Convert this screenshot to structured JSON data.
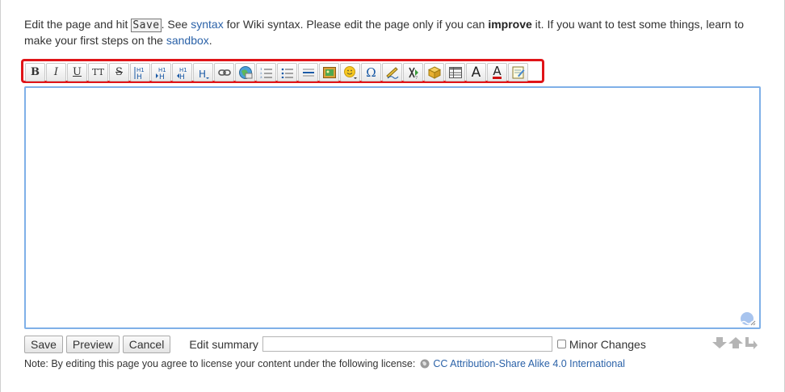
{
  "intro": {
    "part1": "Edit the page and hit ",
    "save_key": "Save",
    "part2": ". See ",
    "syntax_link": "syntax",
    "part3": " for Wiki syntax. Please edit the page only if you can ",
    "improve": "improve",
    "part4": " it. If you want to test some things, learn to make your first steps on the ",
    "sandbox_link": "sandbox",
    "part5": "."
  },
  "toolbar": {
    "highlight_color": "#e01418",
    "buttons": [
      {
        "name": "bold-button",
        "icon": "bold-icon",
        "label": "B"
      },
      {
        "name": "italic-button",
        "icon": "italic-icon",
        "label": "I"
      },
      {
        "name": "underline-button",
        "icon": "underline-icon",
        "label": "U"
      },
      {
        "name": "monospace-button",
        "icon": "monospace-icon",
        "label": "TT"
      },
      {
        "name": "strikethrough-button",
        "icon": "strikethrough-icon",
        "label": "S"
      },
      {
        "name": "same-level-heading-button",
        "icon": "heading-same-icon",
        "label": "H"
      },
      {
        "name": "lower-heading-button",
        "icon": "heading-lower-icon",
        "label": "H"
      },
      {
        "name": "higher-heading-button",
        "icon": "heading-higher-icon",
        "label": "H"
      },
      {
        "name": "select-heading-button",
        "icon": "heading-select-icon",
        "label": "H"
      },
      {
        "name": "internal-link-button",
        "icon": "link-icon",
        "label": ""
      },
      {
        "name": "external-link-button",
        "icon": "globe-link-icon",
        "label": ""
      },
      {
        "name": "ordered-list-button",
        "icon": "ordered-list-icon",
        "label": ""
      },
      {
        "name": "unordered-list-button",
        "icon": "unordered-list-icon",
        "label": ""
      },
      {
        "name": "horizontal-rule-button",
        "icon": "horizontal-rule-icon",
        "label": ""
      },
      {
        "name": "add-image-button",
        "icon": "image-icon",
        "label": ""
      },
      {
        "name": "smileys-button",
        "icon": "smiley-icon",
        "label": ""
      },
      {
        "name": "special-chars-button",
        "icon": "omega-icon",
        "label": "Ω"
      },
      {
        "name": "insert-signature-button",
        "icon": "signature-icon",
        "label": ""
      },
      {
        "name": "wrap-plugin-button",
        "icon": "wrap-icon",
        "label": ""
      },
      {
        "name": "plugin-box-button",
        "icon": "box-icon",
        "label": ""
      },
      {
        "name": "insert-table-button",
        "icon": "table-icon",
        "label": ""
      },
      {
        "name": "font-size-button",
        "icon": "font-size-icon",
        "label": "A"
      },
      {
        "name": "font-color-button",
        "icon": "font-color-icon",
        "label": "A"
      },
      {
        "name": "edit-note-button",
        "icon": "note-icon",
        "label": ""
      }
    ]
  },
  "editor": {
    "content": "",
    "border_color": "#7fb0e8"
  },
  "controls": {
    "save_label": "Save",
    "preview_label": "Preview",
    "cancel_label": "Cancel",
    "summary_label": "Edit summary",
    "summary_value": "",
    "minor_label": "Minor Changes",
    "minor_checked": false
  },
  "resize_icons": [
    "arrow-down-icon",
    "arrow-up-icon",
    "return-arrow-icon"
  ],
  "note": {
    "text": "Note: By editing this page you agree to license your content under the following license:",
    "license_link": "CC Attribution-Share Alike 4.0 International"
  },
  "colors": {
    "link": "#2b62a8",
    "text": "#333333"
  }
}
